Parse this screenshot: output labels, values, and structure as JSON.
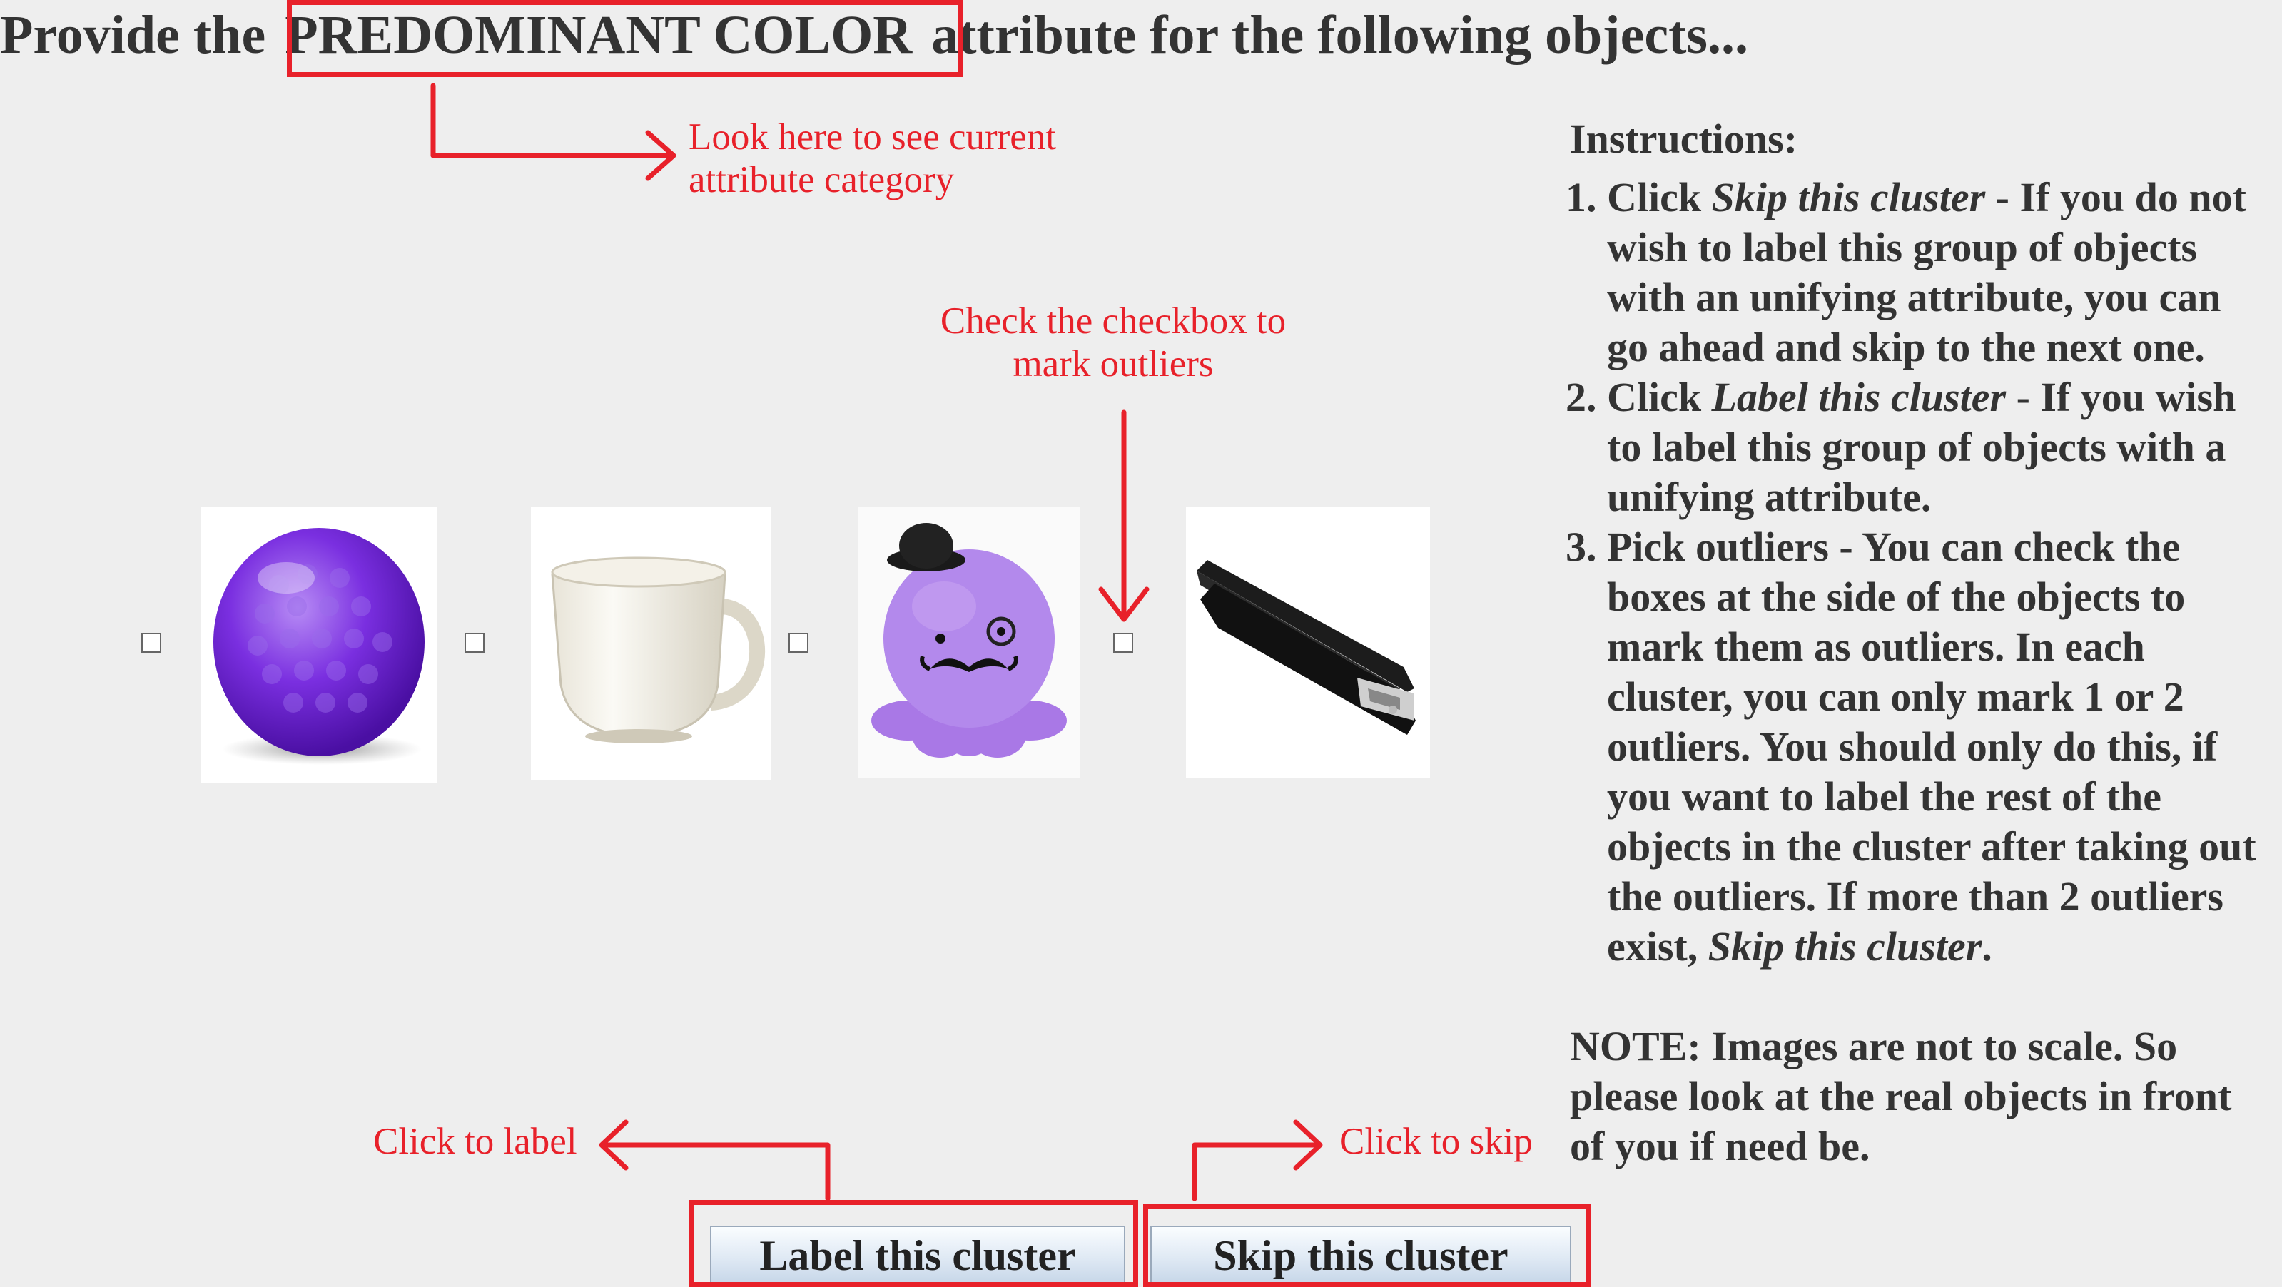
{
  "header": {
    "prefix": "Provide the",
    "attribute": "PREDOMINANT COLOR",
    "suffix": "attribute for the following objects..."
  },
  "annotations": {
    "attribute_note_line1": "Look here to see current",
    "attribute_note_line2": "attribute category",
    "checkbox_note_line1": "Check the checkbox to",
    "checkbox_note_line2": "mark outliers",
    "label_note": "Click to label",
    "skip_note": "Click to skip"
  },
  "objects": [
    {
      "name": "purple-golf-ball",
      "checked": false
    },
    {
      "name": "white-mug",
      "checked": false
    },
    {
      "name": "purple-octopus-plush",
      "checked": false
    },
    {
      "name": "black-stapler",
      "checked": false
    }
  ],
  "instructions": {
    "title": "Instructions:",
    "items": [
      {
        "em": "Skip this cluster",
        "lead": "Click ",
        "text": " - If you do not wish to label this group of objects with an unifying attribute, you can go ahead and skip to the next one."
      },
      {
        "em": "Label this cluster",
        "lead": "Click ",
        "text": " - If you wish to label this group of objects with a unifying attribute."
      },
      {
        "lead": "Pick outliers - You can check the boxes at the side of the objects to mark them as outliers. In each cluster, you can only mark 1 or 2 outliers. You should only do this, if you want to label the rest of the objects in the cluster after taking out the outliers. If more than 2 outliers exist, ",
        "em": "Skip this cluster",
        "text": "."
      }
    ],
    "note": "NOTE: Images are not to scale. So please look at the real objects in front of you if need be."
  },
  "buttons": {
    "label": "Label this cluster",
    "skip": "Skip this cluster"
  },
  "colors": {
    "annotation_red": "#e8212a",
    "text": "#333333",
    "background": "#eeeeee"
  }
}
